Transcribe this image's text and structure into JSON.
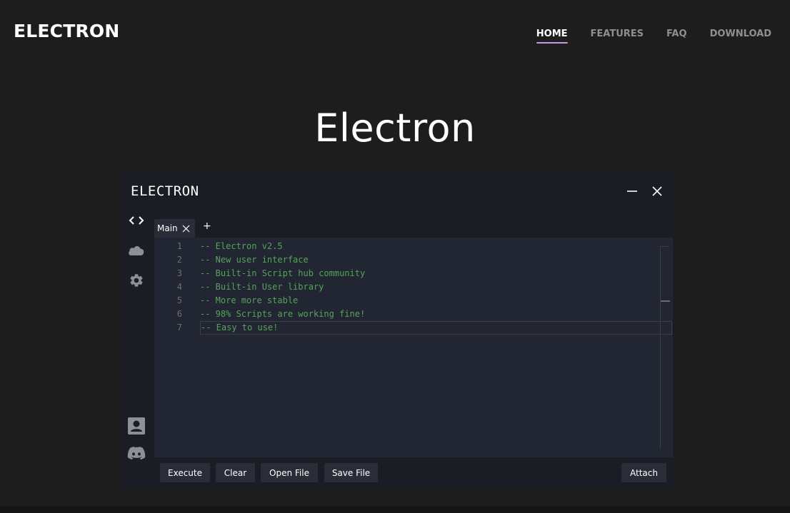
{
  "site": {
    "brand": "ELECTRON",
    "nav": [
      {
        "label": "HOME",
        "active": true
      },
      {
        "label": "FEATURES",
        "active": false
      },
      {
        "label": "FAQ",
        "active": false
      },
      {
        "label": "DOWNLOAD",
        "active": false
      }
    ],
    "hero_title": "Electron"
  },
  "app": {
    "title": "ELECTRON",
    "tabs": [
      {
        "label": "Main"
      }
    ],
    "add_tab_label": "+",
    "editor": {
      "line_numbers": [
        "1",
        "2",
        "3",
        "4",
        "5",
        "6",
        "7"
      ],
      "lines": [
        "-- Electron v2.5",
        "-- New user interface",
        "-- Built-in Script hub community",
        "-- Built-in User library",
        "-- More more stable",
        "-- 98% Scripts are working fine!",
        "-- Easy to use!"
      ]
    },
    "buttons": {
      "execute": "Execute",
      "clear": "Clear",
      "open_file": "Open File",
      "save_file": "Save File",
      "attach": "Attach"
    }
  },
  "colors": {
    "page_bg": "#1d1d1d",
    "nav_active_underline": "#c896e6",
    "window_bg": "#1b1d25",
    "editor_bg": "#222532",
    "code_comment": "#56a35b",
    "button_bg": "#2a2d38"
  },
  "icons": {
    "sidebar": [
      "code-icon",
      "cloud-icon",
      "gear-icon",
      "user-icon",
      "discord-icon"
    ],
    "window": [
      "minimize-icon",
      "close-icon"
    ]
  }
}
